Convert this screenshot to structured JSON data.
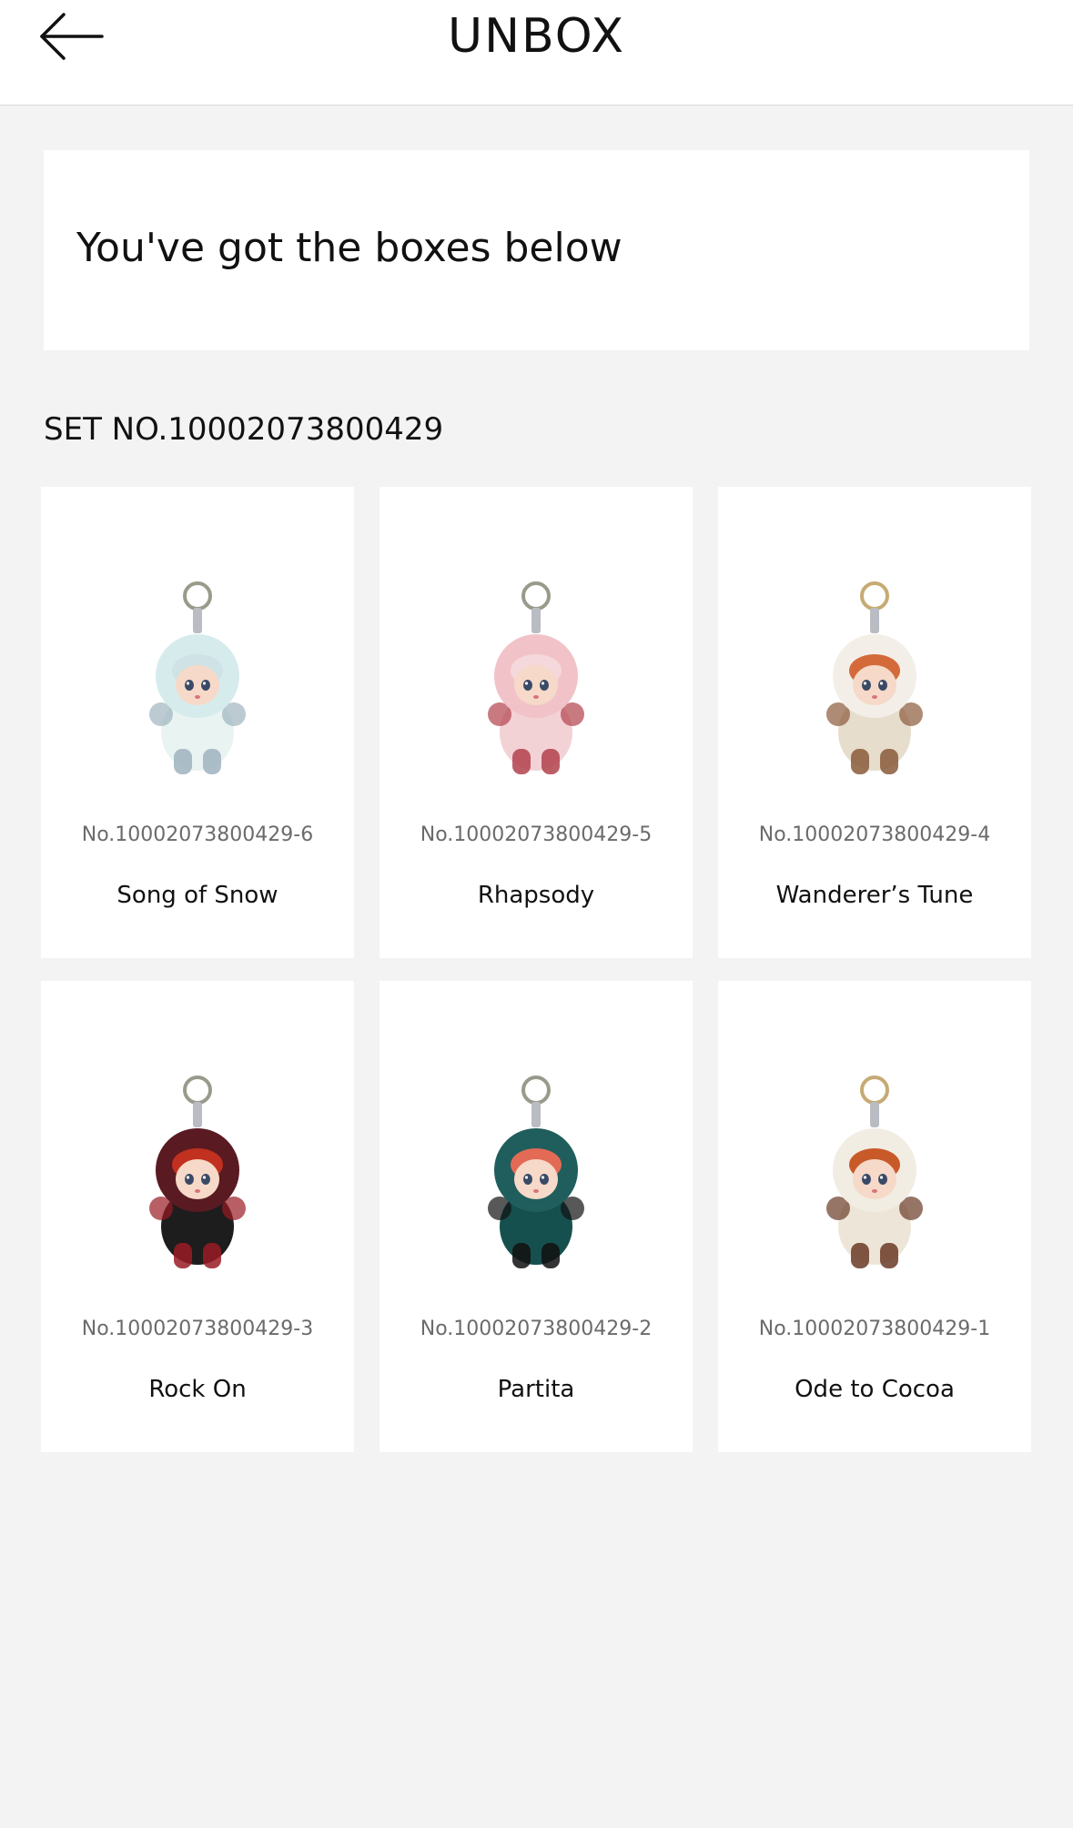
{
  "header": {
    "title": "UNBOX",
    "back_icon": "arrow-left-icon"
  },
  "notice": {
    "text": "You've got the boxes below"
  },
  "set": {
    "label": "SET NO.10002073800429"
  },
  "boxes": [
    {
      "serial": "No.10002073800429-6",
      "name": "Song of Snow",
      "image": "doll-figure-icon",
      "colors": {
        "hood": "#d6ecec",
        "body": "#e8f3f2",
        "accent": "#9fb3bf",
        "hair": "#cfe2e5",
        "ring": "#9a9a8c"
      }
    },
    {
      "serial": "No.10002073800429-5",
      "name": "Rhapsody",
      "image": "doll-figure-icon",
      "colors": {
        "hood": "#f1c3c9",
        "body": "#f3d2d6",
        "accent": "#b2424c",
        "hair": "#f5d8db",
        "ring": "#9a9a8c"
      }
    },
    {
      "serial": "No.10002073800429-4",
      "name": "Wanderer’s Tune",
      "image": "doll-figure-icon",
      "colors": {
        "hood": "#f3efe8",
        "body": "#e7ddcd",
        "accent": "#8a5a3a",
        "hair": "#d46a3a",
        "ring": "#c5ab73"
      }
    },
    {
      "serial": "No.10002073800429-3",
      "name": "Rock On",
      "image": "doll-figure-icon",
      "colors": {
        "hood": "#5a1a22",
        "body": "#1d1d1d",
        "accent": "#9a1b24",
        "hair": "#c2301f",
        "ring": "#9a9a8c"
      }
    },
    {
      "serial": "No.10002073800429-2",
      "name": "Partita",
      "image": "doll-figure-icon",
      "colors": {
        "hood": "#1f5e5c",
        "body": "#16504e",
        "accent": "#111111",
        "hair": "#e36a55",
        "ring": "#9a9a8c"
      }
    },
    {
      "serial": "No.10002073800429-1",
      "name": "Ode to Cocoa",
      "image": "doll-figure-icon",
      "colors": {
        "hood": "#f2ede3",
        "body": "#ede6d8",
        "accent": "#6a3a26",
        "hair": "#c85a2a",
        "ring": "#c5ab73"
      }
    }
  ]
}
